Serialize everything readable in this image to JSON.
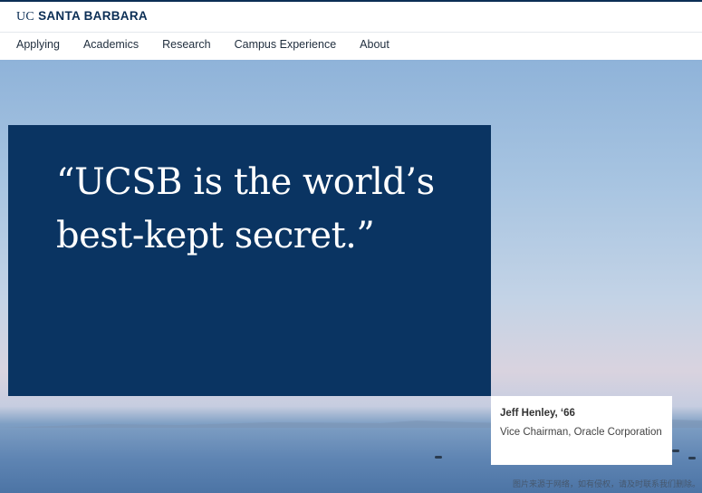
{
  "header": {
    "logo_uc": "UC",
    "logo_name": "SANTA BARBARA"
  },
  "nav": {
    "items": [
      {
        "label": "Applying"
      },
      {
        "label": "Academics"
      },
      {
        "label": "Research"
      },
      {
        "label": "Campus Experience"
      },
      {
        "label": "About"
      }
    ]
  },
  "hero": {
    "quote_line1": "“UCSB is the world’s",
    "quote_line2": "best-kept secret.”",
    "attribution_name": "Jeff Henley, ‘66",
    "attribution_role": "Vice Chairman, Oracle Corporation",
    "watermark": "图片来源于网络，如有侵权，请及时联系我们删除。"
  },
  "colors": {
    "brand_navy": "#0a3462",
    "header_text": "#0b2e55"
  }
}
